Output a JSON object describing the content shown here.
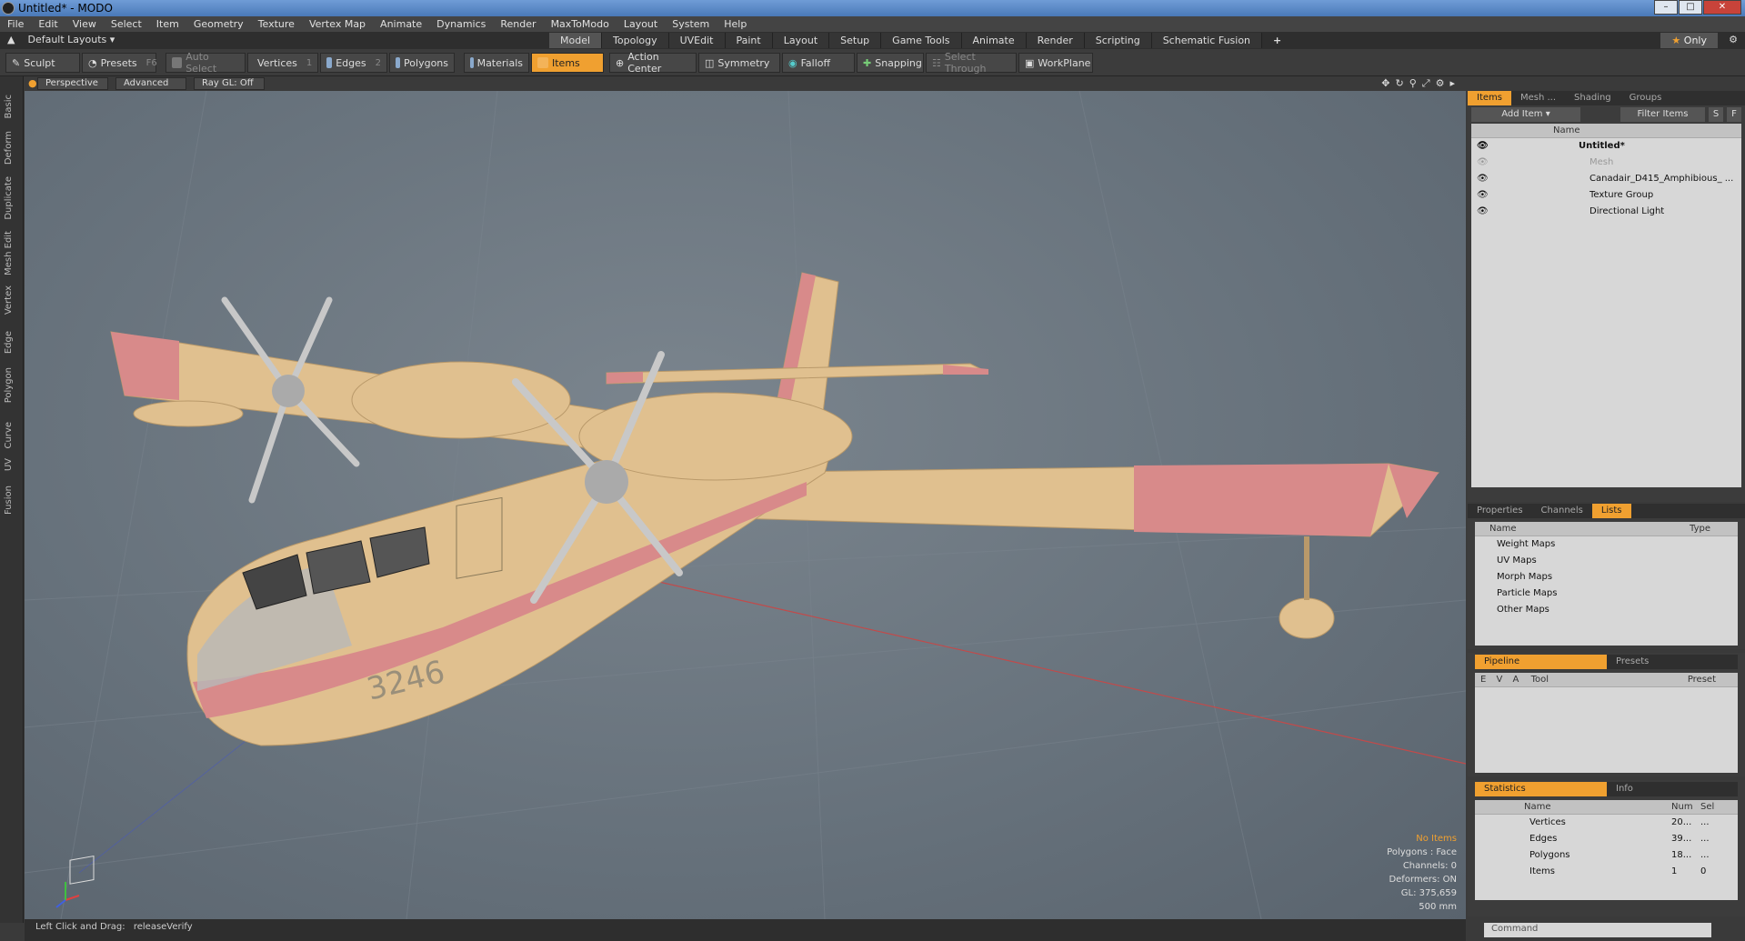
{
  "window": {
    "title": "Untitled* - MODO"
  },
  "menu": [
    "File",
    "Edit",
    "View",
    "Select",
    "Item",
    "Geometry",
    "Texture",
    "Vertex Map",
    "Animate",
    "Dynamics",
    "Render",
    "MaxToModo",
    "Layout",
    "System",
    "Help"
  ],
  "layouts_label": "Default Layouts",
  "tabs": [
    "Model",
    "Topology",
    "UVEdit",
    "Paint",
    "Layout",
    "Setup",
    "Game Tools",
    "Animate",
    "Render",
    "Scripting",
    "Schematic Fusion"
  ],
  "only_label": "Only",
  "toolbar": {
    "sculpt": "Sculpt",
    "presets": "Presets",
    "presets_key": "F6",
    "auto_select": "Auto Select",
    "vertices": "Vertices",
    "vertices_key": "1",
    "edges": "Edges",
    "edges_key": "2",
    "polygons": "Polygons",
    "materials": "Materials",
    "items": "Items",
    "action_center": "Action Center",
    "symmetry": "Symmetry",
    "falloff": "Falloff",
    "snapping": "Snapping",
    "select_through": "Select Through",
    "workplane": "WorkPlane"
  },
  "left_tabs": [
    "Basic",
    "Deform",
    "Duplicate",
    "Mesh Edit",
    "Vertex",
    "Edge",
    "Polygon",
    "Curve",
    "UV",
    "Fusion"
  ],
  "viewport": {
    "perspective": "Perspective",
    "advanced": "Advanced",
    "raygl": "Ray GL: Off",
    "aircraft_number": "3246",
    "stats": [
      "No Items",
      "Polygons : Face",
      "Channels: 0",
      "Deformers: ON",
      "GL: 375,659",
      "500 mm"
    ]
  },
  "status": {
    "hint": "Left Click and Drag:",
    "action": "releaseVerify"
  },
  "items_panel": {
    "tabs": [
      "Items",
      "Mesh ...",
      "Shading",
      "Groups"
    ],
    "add_item": "Add Item",
    "filter": "Filter Items",
    "s": "S",
    "f": "F",
    "name_header": "Name",
    "rows": [
      "Untitled*",
      "Mesh",
      "Canadair_D415_Amphibious_ ...",
      "Texture Group",
      "Directional Light"
    ]
  },
  "lists_panel": {
    "tabs": [
      "Properties",
      "Channels",
      "Lists"
    ],
    "name_header": "Name",
    "type_header": "Type",
    "rows": [
      "Weight Maps",
      "UV Maps",
      "Morph Maps",
      "Particle Maps",
      "Other Maps"
    ]
  },
  "pipeline_panel": {
    "tabs": [
      "Pipeline",
      "Presets"
    ],
    "cols": [
      "E",
      "V",
      "A",
      "Tool",
      "Preset"
    ]
  },
  "stats_panel": {
    "tabs": [
      "Statistics",
      "Info"
    ],
    "cols": [
      "Name",
      "Num",
      "Sel"
    ],
    "rows": [
      {
        "name": "Vertices",
        "num": "20...",
        "sel": "..."
      },
      {
        "name": "Edges",
        "num": "39...",
        "sel": "..."
      },
      {
        "name": "Polygons",
        "num": "18...",
        "sel": "..."
      },
      {
        "name": "Items",
        "num": "1",
        "sel": "0"
      }
    ]
  },
  "command_placeholder": "Command",
  "colors": {
    "accent": "#f0a030",
    "hull": "#e0c08f",
    "stripe": "#d88a8a"
  }
}
